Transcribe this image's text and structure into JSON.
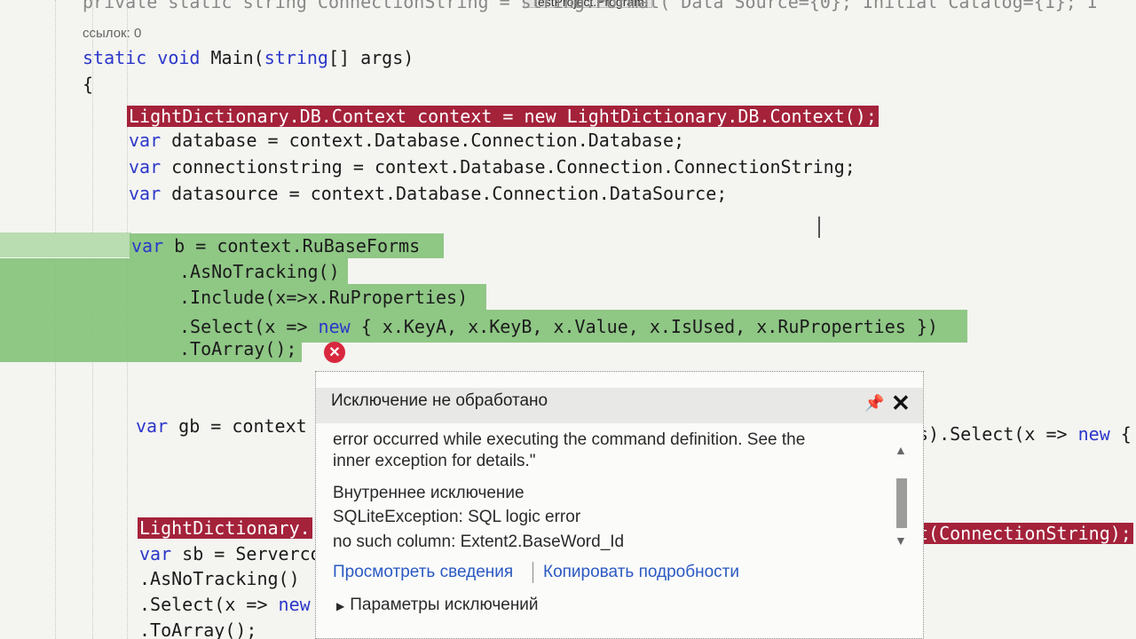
{
  "tab": {
    "title": "TestProject.Program"
  },
  "code": {
    "line_connstr": "private static string ConnectionString = string.Format(\"Data Source={0}; Initial Catalog={1}; I",
    "codelens": "ссылок: 0",
    "main_kw": "static void",
    "main_name": " Main(",
    "main_type": "string",
    "main_rest": "[] args)",
    "open_brace": "{",
    "context_line": "LightDictionary.DB.Context context = new LightDictionary.DB.Context();",
    "var_kw": "var",
    "database_line": " database = context.Database.Connection.Database;",
    "connstring_line": " connectionstring = context.Database.Connection.ConnectionString;",
    "datasource_line": " datasource = context.Database.Connection.DataSource;",
    "b_line": " b = context.RuBaseForms",
    "asnotracking": ".AsNoTracking()",
    "include": ".Include(x=>x.RuProperties)",
    "select_pre": ".Select(x => ",
    "new_kw": "new",
    "select_post": " { x.KeyA, x.KeyB, x.Value, x.IsUsed, x.RuProperties })",
    "toarray": ".ToArray();",
    "gb_line": " gb = context",
    "gb_tail_pre": "s).Select(x => ",
    "gb_tail_post": " {",
    "ld_left": "LightDictionary.",
    "ld_right": "t(ConnectionString);",
    "sb_line": " sb = Serverco",
    "sb_asnotracking": ".AsNoTracking()",
    "sb_select_pre": ".Select(x => ",
    "sb_toarray": ".ToArray();"
  },
  "exception": {
    "title": "Исключение не обработано",
    "message_line1": "error occurred while executing the command definition. See the",
    "message_line2": "inner exception for details.\"",
    "inner_header": "Внутреннее исключение",
    "inner_line1": "SQLiteException: SQL logic error",
    "inner_line2": "no such column: Extent2.BaseWord_Id",
    "link_view": "Просмотреть сведения",
    "link_copy": "Копировать подробности",
    "settings": "Параметры исключений"
  }
}
